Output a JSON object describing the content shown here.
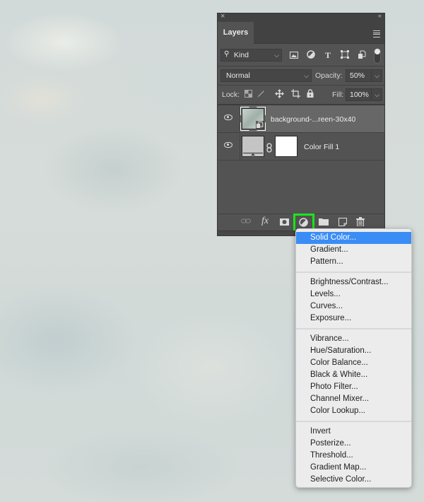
{
  "panel": {
    "close_glyph": "×",
    "collapse_glyph": "‹‹",
    "tab_label": "Layers",
    "filter": {
      "search_icon": "search-icon",
      "value": "Kind"
    },
    "filter_icons": [
      "image-filter-icon",
      "adjustment-filter-icon",
      "type-filter-icon",
      "shape-filter-icon",
      "smart-object-filter-icon"
    ],
    "blend_mode": "Normal",
    "opacity_label": "Opacity:",
    "opacity_value": "50%",
    "lock_label": "Lock:",
    "fill_label": "Fill:",
    "fill_value": "100%",
    "layers": [
      {
        "name": "background-...reen-30x40",
        "visible": true,
        "selected": true,
        "type": "smart-object"
      },
      {
        "name": "Color Fill 1",
        "visible": true,
        "selected": false,
        "type": "fill-layer"
      }
    ],
    "footer_icons": [
      "link-layers-icon",
      "fx-icon",
      "add-mask-icon",
      "adjustment-layer-icon",
      "group-folder-icon",
      "new-layer-icon",
      "trash-icon"
    ],
    "fx_label": "fx"
  },
  "accent": {
    "highlight": "#19e619",
    "menu_selected": "#3a8df5"
  },
  "dropdown": {
    "groups": [
      [
        "Solid Color...",
        "Gradient...",
        "Pattern..."
      ],
      [
        "Brightness/Contrast...",
        "Levels...",
        "Curves...",
        "Exposure..."
      ],
      [
        "Vibrance...",
        "Hue/Saturation...",
        "Color Balance...",
        "Black & White...",
        "Photo Filter...",
        "Channel Mixer...",
        "Color Lookup..."
      ],
      [
        "Invert",
        "Posterize...",
        "Threshold...",
        "Gradient Map...",
        "Selective Color..."
      ]
    ],
    "active_item": "Solid Color..."
  }
}
